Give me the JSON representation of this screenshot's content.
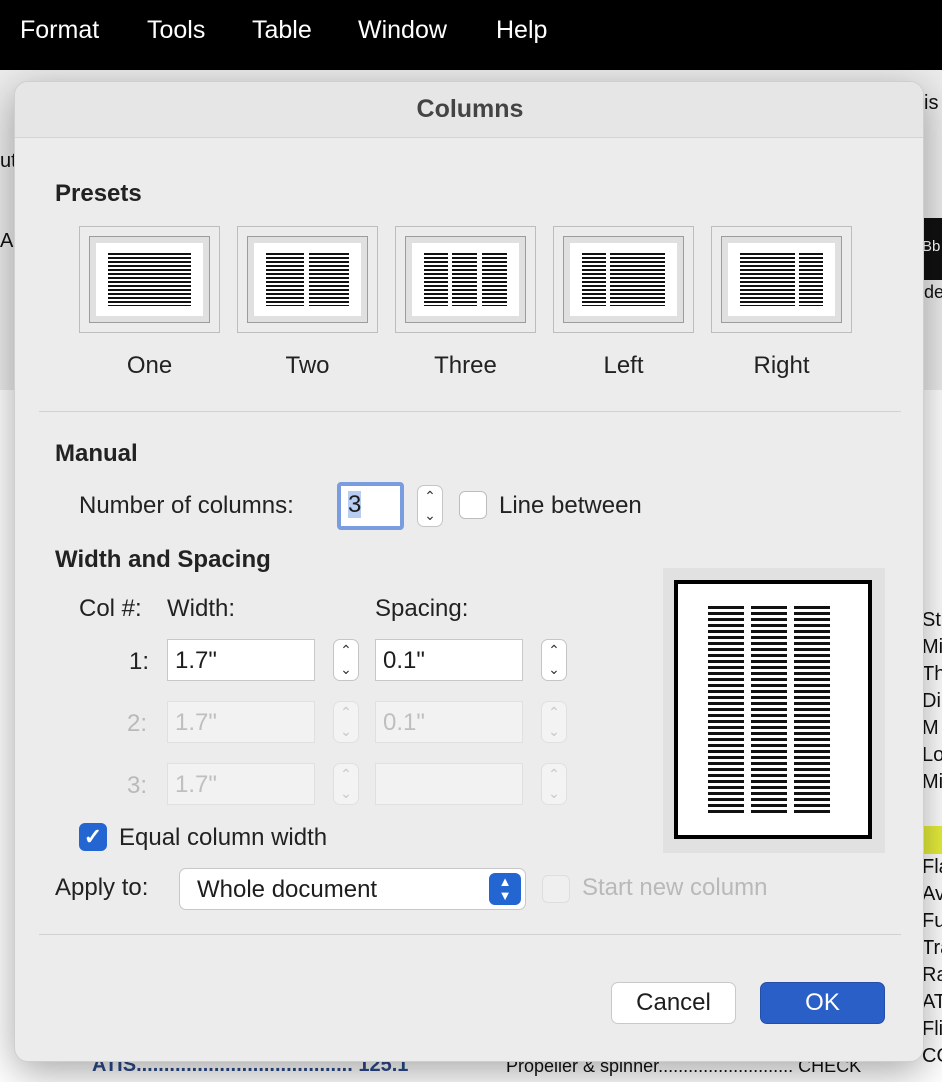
{
  "menubar": {
    "items": [
      "Format",
      "Tools",
      "Table",
      "Window",
      "Help"
    ]
  },
  "background": {
    "right_texts": [
      "Bb",
      "de",
      "St",
      "Mix",
      "Th",
      "Dil",
      "M",
      "Lo",
      "Mix",
      "Fla",
      "Av",
      "Fu",
      "Tra",
      "Ra",
      "AT",
      "Fli",
      "CO"
    ],
    "left_texts": [
      "ut",
      "A"
    ],
    "top_right_text": "is",
    "bottom_left": "ATIS....................................... 125.1",
    "bottom_mid": "Propeller & spinner........................... CHECK"
  },
  "dialog": {
    "title": "Columns",
    "presets_heading": "Presets",
    "presets": [
      "One",
      "Two",
      "Three",
      "Left",
      "Right"
    ],
    "manual_heading": "Manual",
    "num_columns_label": "Number of columns:",
    "num_columns_value": "3",
    "line_between_label": "Line between",
    "width_spacing_heading": "Width and Spacing",
    "col_header": "Col #:",
    "width_header": "Width:",
    "spacing_header": "Spacing:",
    "rows": [
      {
        "num": "1:",
        "width": "1.7\"",
        "spacing": "0.1\""
      },
      {
        "num": "2:",
        "width": "1.7\"",
        "spacing": "0.1\""
      },
      {
        "num": "3:",
        "width": "1.7\"",
        "spacing": ""
      }
    ],
    "equal_width_label": "Equal column width",
    "equal_width_checked": true,
    "apply_to_label": "Apply to:",
    "apply_to_value": "Whole document",
    "start_new_column_label": "Start new column",
    "cancel_label": "Cancel",
    "ok_label": "OK"
  }
}
